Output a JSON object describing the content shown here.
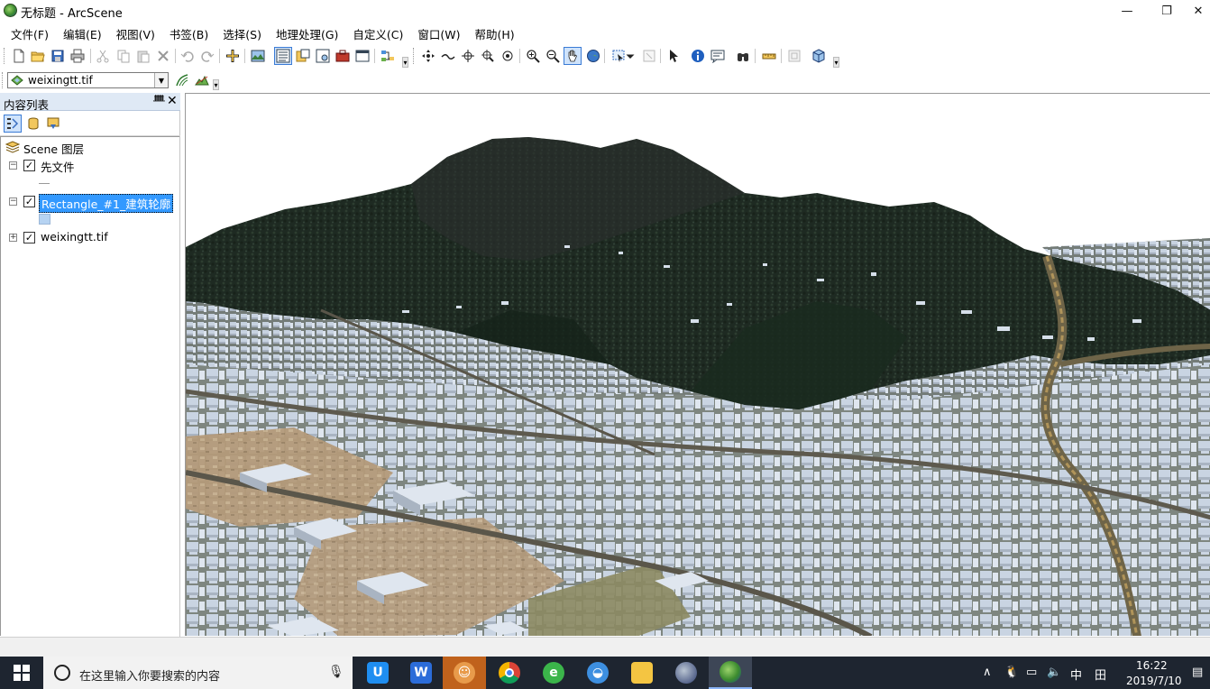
{
  "window": {
    "title": "无标题 - ArcScene",
    "minimize": "—",
    "restore": "❐",
    "close": "✕"
  },
  "menu": [
    "文件(F)",
    "编辑(E)",
    "视图(V)",
    "书签(B)",
    "选择(S)",
    "地理处理(G)",
    "自定义(C)",
    "窗口(W)",
    "帮助(H)"
  ],
  "layer_toolbar": {
    "selected_layer": "weixingtt.tif"
  },
  "toc": {
    "title": "内容列表",
    "pin": "ᚙ",
    "close": "✕",
    "root": "Scene 图层",
    "layers": [
      {
        "label": "先文件",
        "expander": "−",
        "checked": "✓"
      },
      {
        "label": "Rectangle_#1_建筑轮廓",
        "expander": "−",
        "checked": "✓"
      },
      {
        "label": "weixingtt.tif",
        "expander": "+",
        "checked": "✓"
      }
    ]
  },
  "taskbar": {
    "search_placeholder": "在这里输入你要搜索的内容",
    "ime": "中",
    "ime2": "田",
    "time": "16:22",
    "date": "2019/7/10"
  },
  "colors": {
    "accent": "#3399ff",
    "toc_header": "#dfe9f5",
    "taskbar": "#1e2530"
  }
}
